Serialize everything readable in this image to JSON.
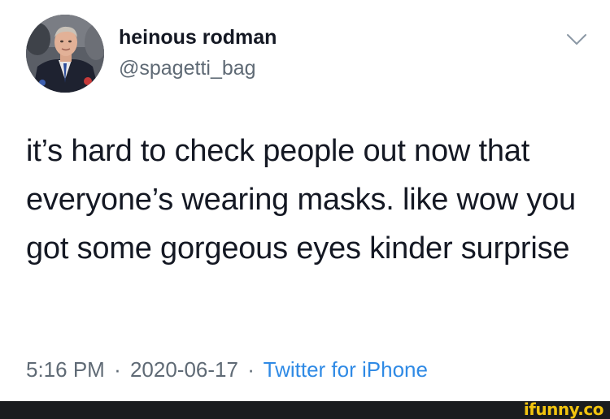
{
  "tweet": {
    "author": {
      "display_name": "heinous rodman",
      "handle": "@spagetti_bag",
      "avatar_icon": "profile-photo"
    },
    "menu_icon": "chevron-down-icon",
    "text": "it’s hard to check people out now that everyone’s wearing masks. like wow you got some gorgeous eyes kinder surprise",
    "meta": {
      "time": "5:16 PM",
      "separator": "·",
      "date": "2020-06-17",
      "source": "Twitter for iPhone"
    }
  },
  "watermark": {
    "text": "ifunny.co"
  },
  "colors": {
    "text": "#141823",
    "secondary": "#5f6a75",
    "link": "#2f8ae5",
    "footer_bar": "#1a1c1f",
    "watermark": "#f2c40f"
  }
}
